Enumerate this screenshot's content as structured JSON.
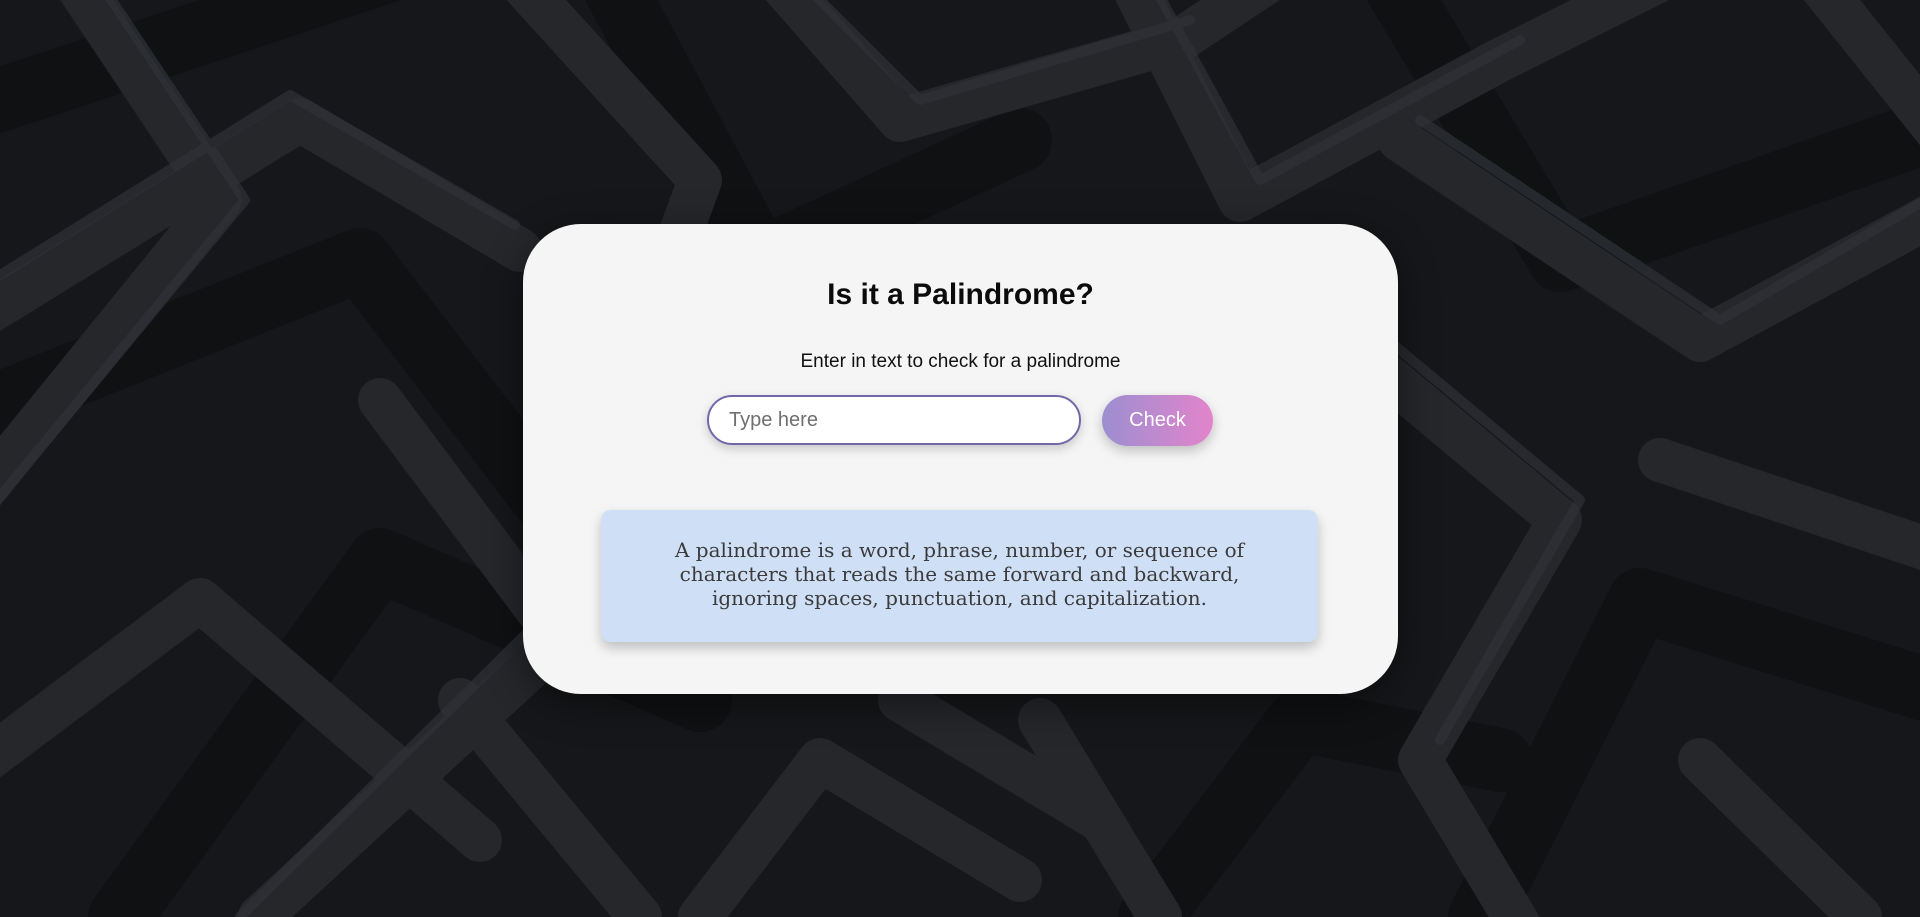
{
  "header": {
    "title": "Is it a Palindrome?"
  },
  "form": {
    "prompt": "Enter in text to check for a palindrome",
    "input_placeholder": "Type here",
    "input_value": "",
    "check_label": "Check"
  },
  "info": {
    "text": "A palindrome is a word, phrase, number, or sequence of characters that reads the same forward and backward, ignoring spaces, punctuation, and capitalization."
  },
  "colors": {
    "background": "#17181b",
    "card": "#f5f5f5",
    "input_border": "#7467a8",
    "button_gradient_start": "#9c8ed0",
    "button_gradient_end": "#e384cb",
    "info_box": "#cfe0f6"
  }
}
